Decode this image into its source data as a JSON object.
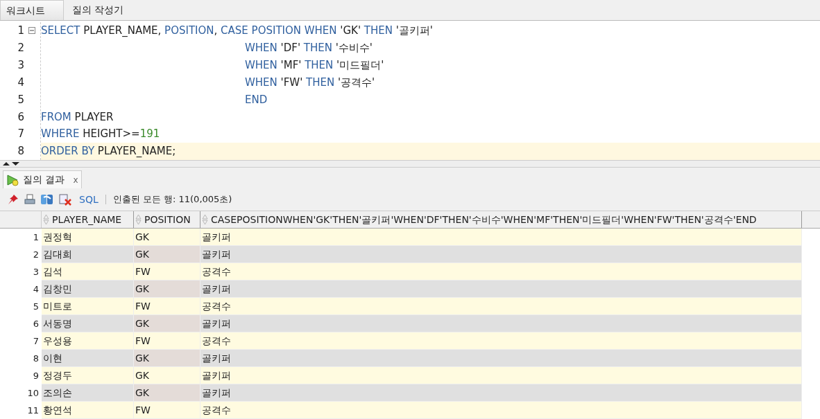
{
  "tabs": [
    {
      "label": "워크시트",
      "selected": true
    },
    {
      "label": "질의 작성기",
      "selected": false
    }
  ],
  "editor": {
    "lines": [
      {
        "number": "1",
        "fold": true,
        "indent": false,
        "current": false,
        "tokens": [
          {
            "kind": "kw",
            "text": "SELECT"
          },
          {
            "kind": "id",
            "text": " PLAYER_NAME, "
          },
          {
            "kind": "kw",
            "text": "POSITION"
          },
          {
            "kind": "id",
            "text": ", "
          },
          {
            "kind": "kw",
            "text": "CASE POSITION WHEN"
          },
          {
            "kind": "str",
            "text": " 'GK' "
          },
          {
            "kind": "kw",
            "text": "THEN"
          },
          {
            "kind": "str",
            "text": " '골키퍼'"
          }
        ]
      },
      {
        "number": "2",
        "fold": false,
        "indent": true,
        "current": false,
        "tokens": [
          {
            "kind": "kw",
            "text": "WHEN"
          },
          {
            "kind": "str",
            "text": " 'DF' "
          },
          {
            "kind": "kw",
            "text": "THEN"
          },
          {
            "kind": "str",
            "text": " '수비수'"
          }
        ]
      },
      {
        "number": "3",
        "fold": false,
        "indent": true,
        "current": false,
        "tokens": [
          {
            "kind": "kw",
            "text": "WHEN"
          },
          {
            "kind": "str",
            "text": " 'MF' "
          },
          {
            "kind": "kw",
            "text": "THEN"
          },
          {
            "kind": "str",
            "text": " '미드필더'"
          }
        ]
      },
      {
        "number": "4",
        "fold": false,
        "indent": true,
        "current": false,
        "tokens": [
          {
            "kind": "kw",
            "text": "WHEN"
          },
          {
            "kind": "str",
            "text": " 'FW' "
          },
          {
            "kind": "kw",
            "text": "THEN"
          },
          {
            "kind": "str",
            "text": " '공격수'"
          }
        ]
      },
      {
        "number": "5",
        "fold": false,
        "indent": true,
        "current": false,
        "tokens": [
          {
            "kind": "kw",
            "text": "END"
          }
        ]
      },
      {
        "number": "6",
        "fold": false,
        "indent": false,
        "current": false,
        "tokens": [
          {
            "kind": "kw",
            "text": "FROM"
          },
          {
            "kind": "id",
            "text": " PLAYER"
          }
        ]
      },
      {
        "number": "7",
        "fold": false,
        "indent": false,
        "current": false,
        "tokens": [
          {
            "kind": "kw",
            "text": "WHERE"
          },
          {
            "kind": "id",
            "text": " HEIGHT>="
          },
          {
            "kind": "num",
            "text": "191"
          }
        ]
      },
      {
        "number": "8",
        "fold": false,
        "indent": false,
        "current": true,
        "tokens": [
          {
            "kind": "kw",
            "text": "ORDER BY"
          },
          {
            "kind": "id",
            "text": " PLAYER_NAME;"
          }
        ]
      }
    ]
  },
  "results": {
    "tab": {
      "label": "질의 결과",
      "close": "x",
      "selected": true
    },
    "toolbar": {
      "sql": "SQL",
      "status": "인출된 모든 행: 11(0,005초)"
    },
    "table": {
      "columns": [
        "PLAYER_NAME",
        "POSITION",
        "CASEPOSITIONWHEN'GK'THEN'골키퍼'WHEN'DF'THEN'수비수'WHEN'MF'THEN'미드필더'WHEN'FW'THEN'공격수'END"
      ],
      "rows": [
        {
          "number": "1",
          "cells": [
            "권정혁",
            "GK",
            "골키퍼"
          ]
        },
        {
          "number": "2",
          "cells": [
            "김대희",
            "GK",
            "골키퍼"
          ]
        },
        {
          "number": "3",
          "cells": [
            "김석",
            "FW",
            "공격수"
          ]
        },
        {
          "number": "4",
          "cells": [
            "김창민",
            "GK",
            "골키퍼"
          ]
        },
        {
          "number": "5",
          "cells": [
            "미트로",
            "FW",
            "공격수"
          ]
        },
        {
          "number": "6",
          "cells": [
            "서동명",
            "GK",
            "골키퍼"
          ]
        },
        {
          "number": "7",
          "cells": [
            "우성용",
            "FW",
            "공격수"
          ]
        },
        {
          "number": "8",
          "cells": [
            "이현",
            "GK",
            "골키퍼"
          ]
        },
        {
          "number": "9",
          "cells": [
            "정경두",
            "GK",
            "골키퍼"
          ]
        },
        {
          "number": "10",
          "cells": [
            "조의손",
            "GK",
            "골키퍼"
          ]
        },
        {
          "number": "11",
          "cells": [
            "황연석",
            "FW",
            "공격수"
          ]
        }
      ]
    }
  }
}
